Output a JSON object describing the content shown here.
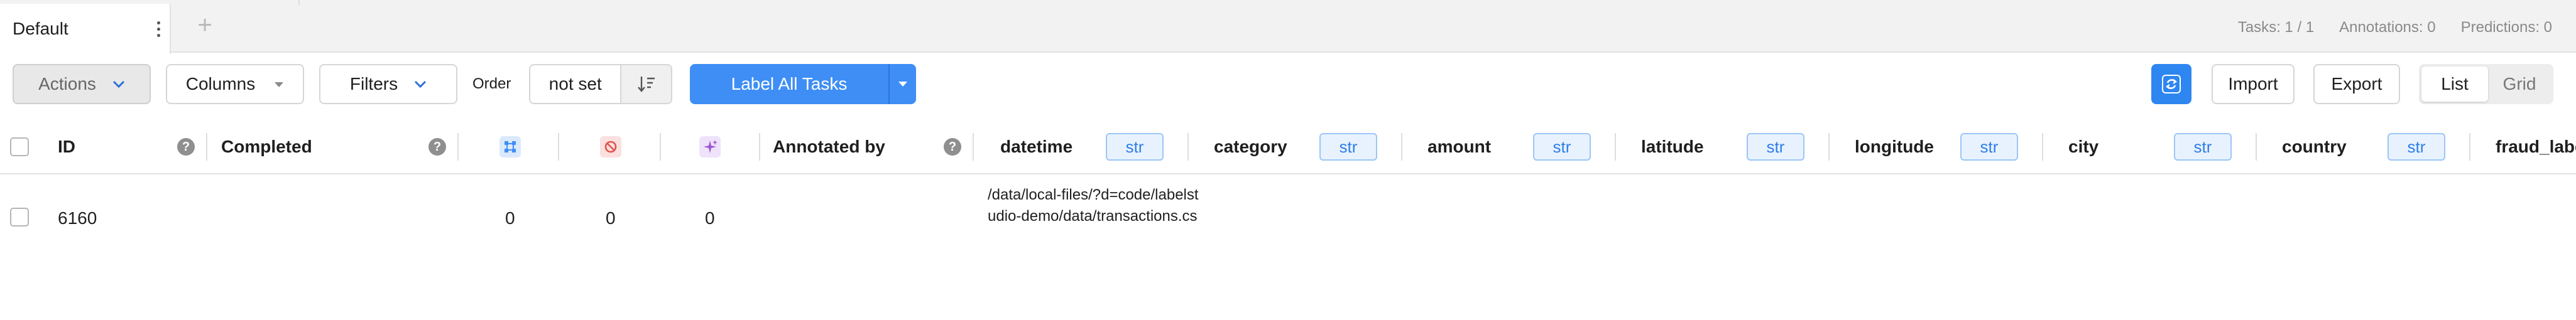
{
  "tabbar": {
    "active_tab": "Default",
    "add_tab_symbol": "+",
    "stats": {
      "tasks": "Tasks: 1 / 1",
      "annotations": "Annotations: 0",
      "predictions": "Predictions: 0"
    }
  },
  "toolbar": {
    "actions_label": "Actions",
    "columns_label": "Columns",
    "filters_label": "Filters",
    "order_label": "Order",
    "order_value": "not set",
    "label_all_label": "Label All Tasks",
    "import_label": "Import",
    "export_label": "Export",
    "view_list_label": "List",
    "view_grid_label": "Grid"
  },
  "columns": {
    "id": "ID",
    "completed": "Completed",
    "annotated_by": "Annotated by",
    "datetime": "datetime",
    "category": "category",
    "amount": "amount",
    "latitude": "latitude",
    "longitude": "longitude",
    "city": "city",
    "country": "country",
    "fraud_label": "fraud_label",
    "type_badge": "str",
    "help_symbol": "?"
  },
  "rows": [
    {
      "id": "6160",
      "total_annotations": "0",
      "cancelled_annotations": "0",
      "total_predictions": "0",
      "datetime": "/data/local-files/?d=code/labelstudio-demo/data/transactions.cs"
    }
  ],
  "colors": {
    "accent": "#3e8ef5",
    "refresh": "#2e86f0",
    "badge_text": "#2f7ee8",
    "badge_bg": "#e8f2fe",
    "annotations_icon": "#3e8ef5",
    "cancelled_icon": "#e0554f",
    "predictions_icon": "#9b59d6"
  },
  "icons": {
    "tab_menu": "vertical-dots-icon",
    "sort": "sort-descending-icon",
    "refresh": "refresh-icon",
    "annotations": "annotations-count-icon",
    "cancelled": "cancelled-icon",
    "predictions": "predictions-sparkle-icon"
  }
}
